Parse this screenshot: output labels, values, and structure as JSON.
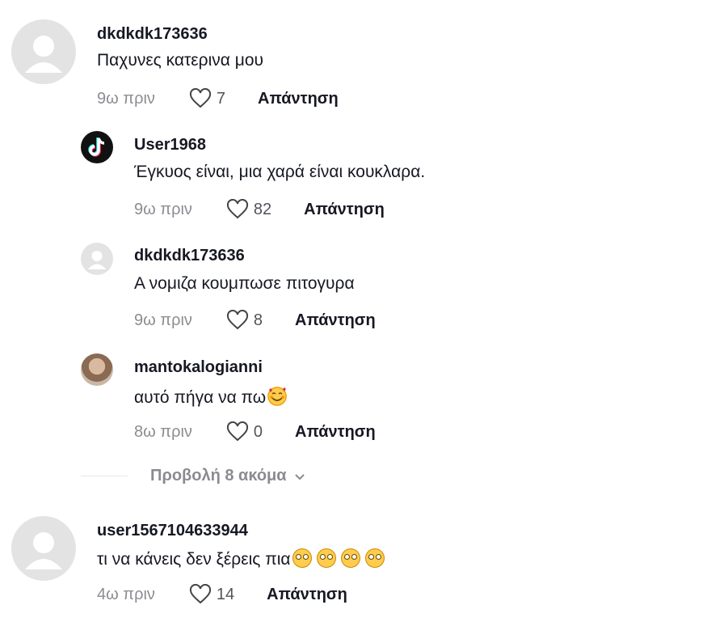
{
  "comments": [
    {
      "username": "dkdkdk173636",
      "text": "Παχυνες κατερινα μου",
      "time": "9ω πριν",
      "likes": "7",
      "reply": "Απάντηση"
    },
    {
      "username": "User1968",
      "text": "Έγκυος είναι, μια χαρά είναι κουκλαρα.",
      "time": "9ω πριν",
      "likes": "82",
      "reply": "Απάντηση"
    },
    {
      "username": "dkdkdk173636",
      "text": "Α νομιζα κουμπωσε πιτογυρα",
      "time": "9ω πριν",
      "likes": "8",
      "reply": "Απάντηση"
    },
    {
      "username": "mantokalogianni",
      "text": "αυτό πήγα να πω",
      "emoji": "smiling-face-with-hearts",
      "time": "8ω πριν",
      "likes": "0",
      "reply": "Απάντηση"
    },
    {
      "username": "user1567104633944",
      "text": "τι να κάνεις δεν ξέρεις πια",
      "emoji": "flushed-face",
      "emoji_count": 4,
      "time": "4ω πριν",
      "likes": "14",
      "reply": "Απάντηση"
    }
  ],
  "view_more": {
    "label": "Προβολή 8 ακόμα",
    "icon": "chevron-down-icon"
  },
  "icons": {
    "like": "heart-outline-icon",
    "tiktok": "tiktok-logo-icon",
    "default_avatar": "default-avatar-icon"
  }
}
